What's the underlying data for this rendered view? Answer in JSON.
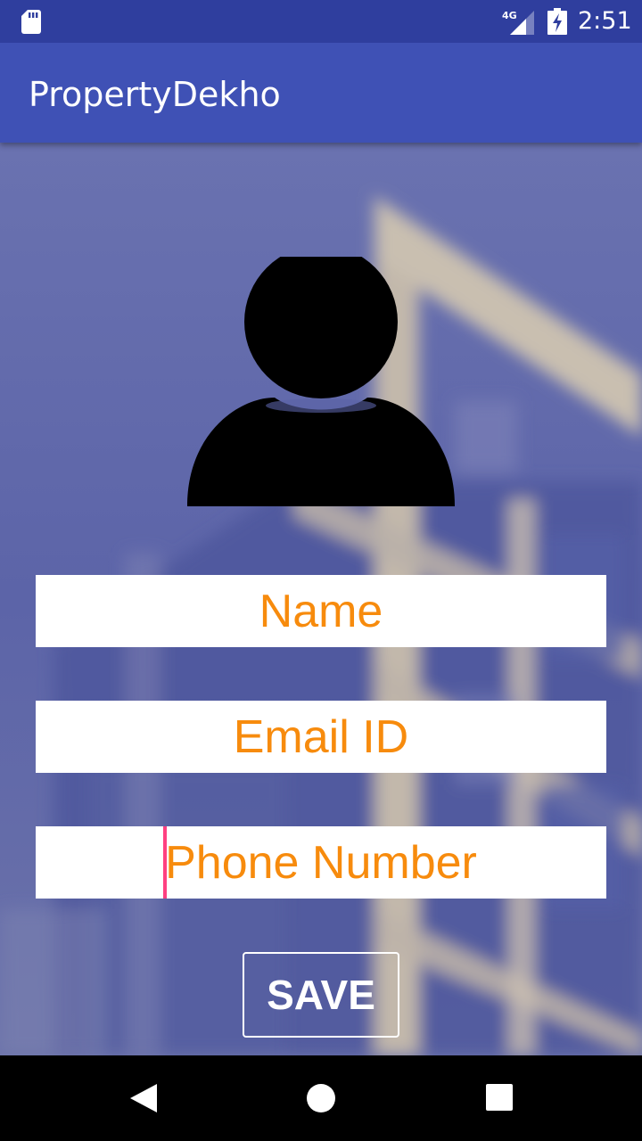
{
  "status_bar": {
    "time": "2:51",
    "network_type": "4G",
    "icons": [
      "sd-card-icon",
      "signal-4g-icon",
      "battery-charging-icon"
    ]
  },
  "app_bar": {
    "title": "PropertyDekho"
  },
  "background": {
    "image": "blurred building photo",
    "tint_color": "#5a63a6"
  },
  "avatar": {
    "icon": "person-icon"
  },
  "form": {
    "name_placeholder": "Name",
    "email_placeholder": "Email ID",
    "phone_placeholder": "Phone Number",
    "name_value": "",
    "email_value": "",
    "phone_value": "",
    "save_label": "SAVE"
  },
  "nav_bar": {
    "icons": [
      "back-icon",
      "home-icon",
      "recents-icon"
    ]
  },
  "colors": {
    "status_bar": "#2f3e9e",
    "app_bar": "#3f51b5",
    "placeholder_text": "#f57c00",
    "cursor": "#ff4081"
  }
}
